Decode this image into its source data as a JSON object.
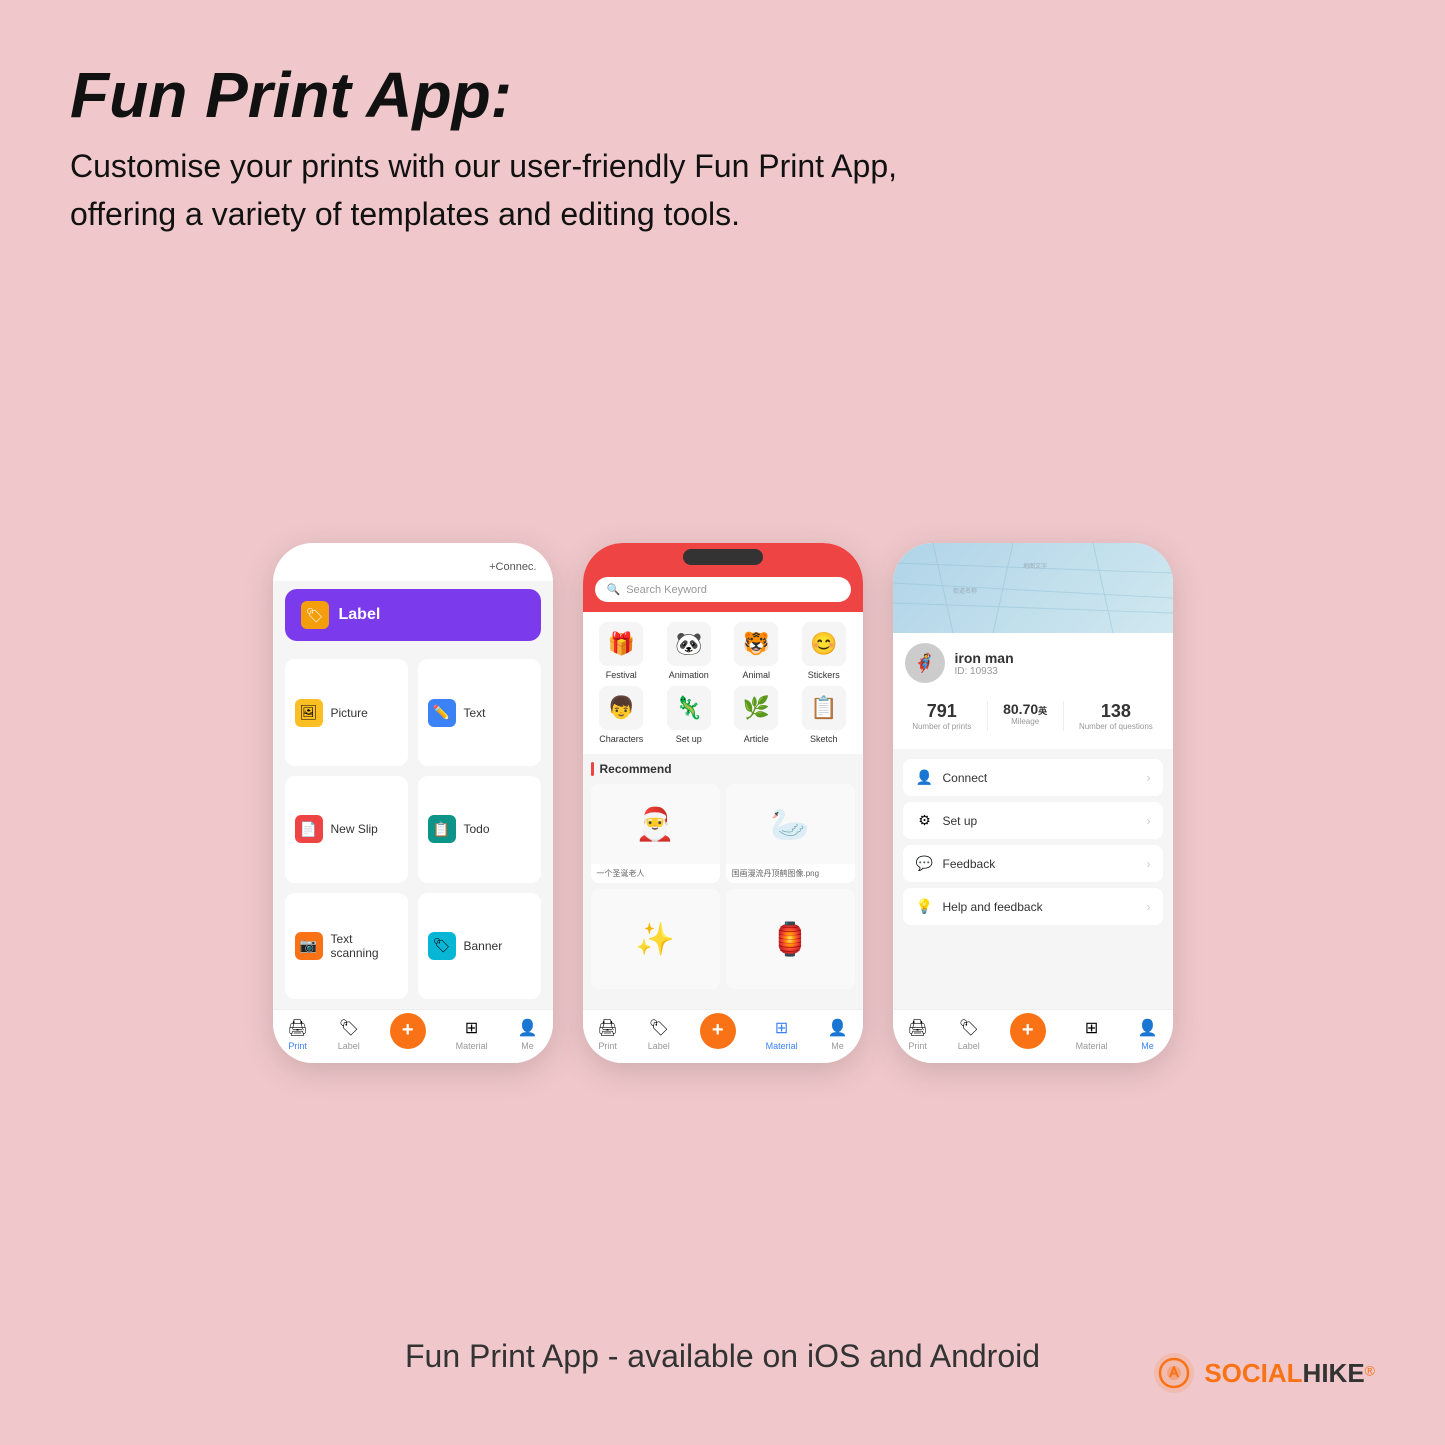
{
  "header": {
    "title": "Fun Print App:",
    "subtitle_line1": "Customise your prints with our user-friendly Fun Print App,",
    "subtitle_line2": "offering a variety of templates and editing tools."
  },
  "phone1": {
    "top_bar_text": "+Connec.",
    "label_header": "Label",
    "menu_items": [
      {
        "label": "Picture",
        "icon": "🖼"
      },
      {
        "label": "Text",
        "icon": "✏️"
      },
      {
        "label": "New Slip",
        "icon": "📄"
      },
      {
        "label": "Todo",
        "icon": "📋"
      },
      {
        "label": "Text scanning",
        "icon": "📷"
      },
      {
        "label": "Banner",
        "icon": "🏷"
      }
    ],
    "nav_items": [
      "Print",
      "Label",
      "",
      "Material",
      "Me"
    ]
  },
  "phone2": {
    "search_placeholder": "Search Keyword",
    "categories": [
      {
        "label": "Festival",
        "icon": "🎁"
      },
      {
        "label": "Animation",
        "icon": "🐼"
      },
      {
        "label": "Animal",
        "icon": "🐯"
      },
      {
        "label": "Stickers",
        "icon": "😊"
      },
      {
        "label": "Characters",
        "icon": "👦"
      },
      {
        "label": "Set up",
        "icon": "🦎"
      },
      {
        "label": "Article",
        "icon": "🌿"
      },
      {
        "label": "Sketch",
        "icon": "📋"
      }
    ],
    "recommend_title": "Recommend",
    "cards": [
      {
        "label": "一个圣诞老人",
        "emoji": "🎅"
      },
      {
        "label": "国画漫流丹顶鹤图像.png",
        "emoji": "🦢"
      },
      {
        "label": "",
        "emoji": "✨"
      },
      {
        "label": "",
        "emoji": "🏮"
      }
    ],
    "nav_items": [
      "Print",
      "Label",
      "",
      "Material",
      "Me"
    ]
  },
  "phone3": {
    "username": "iron man",
    "user_id": "ID: 10933",
    "stats": {
      "prints": {
        "value": "791",
        "label": "Number of prints"
      },
      "mileage": {
        "value": "80.70",
        "unit": "英",
        "label": "Mileage"
      },
      "questions": {
        "value": "138",
        "label": "Number of questions"
      }
    },
    "menu_items": [
      {
        "label": "Connect",
        "icon": "👤"
      },
      {
        "label": "Set up",
        "icon": "⚙"
      },
      {
        "label": "Feedback",
        "icon": "💬"
      },
      {
        "label": "Help and feedback",
        "icon": "💡"
      }
    ],
    "nav_items": [
      "Print",
      "Label",
      "",
      "Material",
      "Me"
    ]
  },
  "caption": "Fun Print App - available on iOS and Android",
  "brand": {
    "name_part1": "SOCIAL",
    "name_part2": "HIKE",
    "reg": "®"
  }
}
